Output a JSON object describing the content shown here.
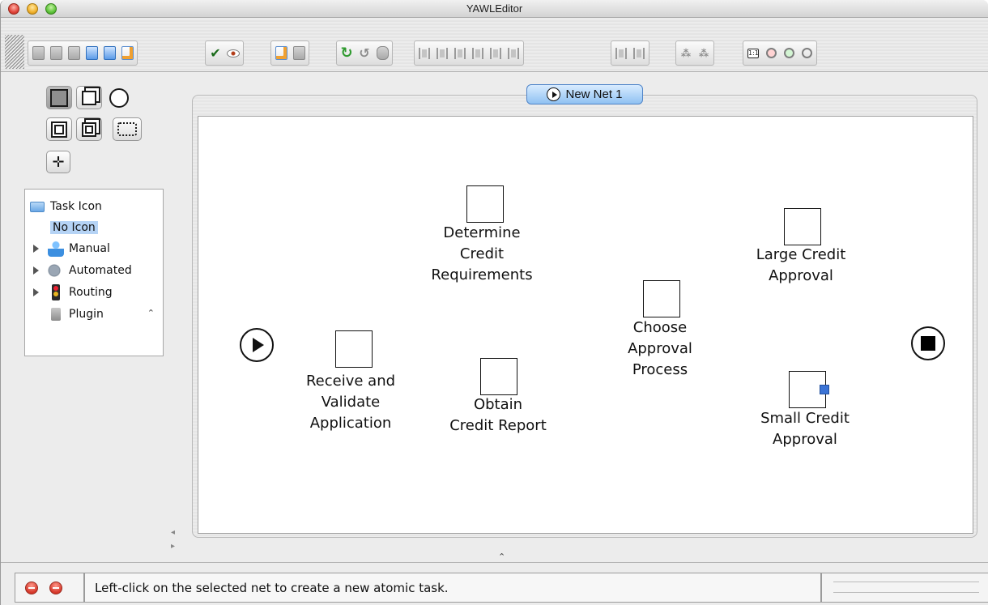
{
  "window": {
    "title": "YAWLEditor"
  },
  "toolbar": {
    "groups": [
      [
        "new-spec",
        "open-spec",
        "close-spec",
        "save-spec",
        "save-spec-as",
        "export-spec"
      ],
      [
        "validate",
        "preview"
      ],
      [
        "add-net",
        "remove-net"
      ],
      [
        "undo",
        "redo",
        "delete"
      ],
      [
        "align-top",
        "align-middle",
        "align-bottom",
        "align-left",
        "align-center",
        "align-right"
      ],
      [
        "increase-size",
        "decrease-size"
      ],
      [
        "add-cancellation",
        "remove-cancellation"
      ],
      [
        "zoom-actual",
        "zoom-out",
        "zoom-in",
        "zoom-selected"
      ]
    ],
    "zoom_actual_label": "1:1"
  },
  "task_icon_tree": {
    "root_label": "Task Icon",
    "selected_label": "No Icon",
    "items": [
      {
        "label": "Manual",
        "icon": "person-icon",
        "expandable": true
      },
      {
        "label": "Automated",
        "icon": "gears-icon",
        "expandable": true
      },
      {
        "label": "Routing",
        "icon": "traffic-light-icon",
        "expandable": true
      },
      {
        "label": "Plugin",
        "icon": "plug-icon",
        "expandable": false
      }
    ]
  },
  "net": {
    "tab_label": "New Net 1",
    "tasks": [
      {
        "id": "receive",
        "label": "Receive and\nValidate\nApplication"
      },
      {
        "id": "determine",
        "label": "Determine\nCredit\nRequirements"
      },
      {
        "id": "obtain",
        "label": "Obtain\nCredit Report"
      },
      {
        "id": "choose",
        "label": "Choose\nApproval\nProcess"
      },
      {
        "id": "large",
        "label": "Large Credit\nApproval"
      },
      {
        "id": "small",
        "label": "Small Credit\nApproval",
        "selected": true
      }
    ]
  },
  "statusbar": {
    "message": "Left-click on the selected net to create a new atomic task."
  },
  "colors": {
    "selection_handle": "#3c74d6",
    "tab_accent": "#8fc1f2"
  }
}
